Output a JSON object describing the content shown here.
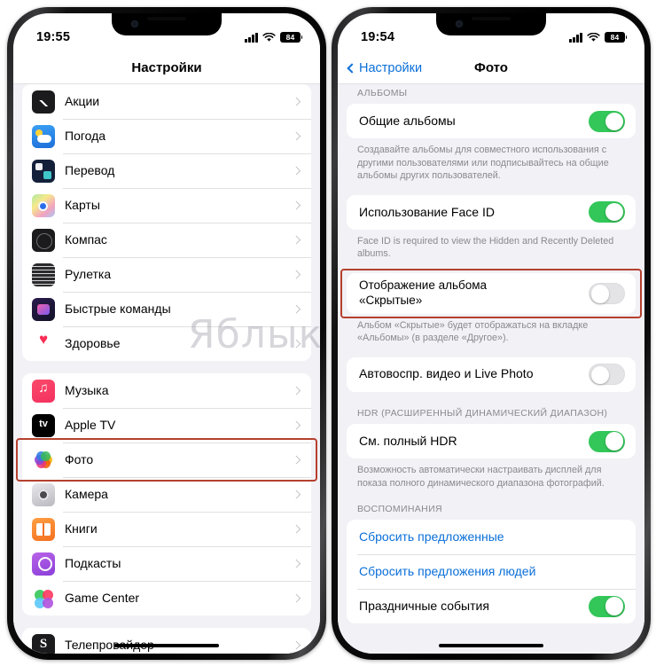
{
  "left_phone": {
    "status_bar": {
      "time": "19:55",
      "battery": "84",
      "signal_icon": "cellular-signal-icon",
      "wifi_icon": "wifi-icon"
    },
    "nav": {
      "title": "Настройки"
    },
    "groups": [
      {
        "name": "apps-group-1",
        "rows": [
          {
            "label": "Акции",
            "icon": "stocks-app-icon",
            "icon_class": "ic-stocks"
          },
          {
            "label": "Погода",
            "icon": "weather-app-icon",
            "icon_class": "ic-weather"
          },
          {
            "label": "Перевод",
            "icon": "translate-app-icon",
            "icon_class": "ic-translate"
          },
          {
            "label": "Карты",
            "icon": "maps-app-icon",
            "icon_class": "ic-maps"
          },
          {
            "label": "Компас",
            "icon": "compass-app-icon",
            "icon_class": "ic-compass"
          },
          {
            "label": "Рулетка",
            "icon": "measure-app-icon",
            "icon_class": "ic-measure"
          },
          {
            "label": "Быстрые команды",
            "icon": "shortcuts-app-icon",
            "icon_class": "ic-shortcuts"
          },
          {
            "label": "Здоровье",
            "icon": "health-app-icon",
            "icon_class": "ic-health"
          }
        ]
      },
      {
        "name": "apps-group-2",
        "rows": [
          {
            "label": "Музыка",
            "icon": "music-app-icon",
            "icon_class": "ic-music"
          },
          {
            "label": "Apple TV",
            "icon": "apple-tv-app-icon",
            "icon_class": "ic-tv"
          },
          {
            "label": "Фото",
            "icon": "photos-app-icon",
            "icon_class": "ic-photos",
            "highlighted": true
          },
          {
            "label": "Камера",
            "icon": "camera-app-icon",
            "icon_class": "ic-camera"
          },
          {
            "label": "Книги",
            "icon": "books-app-icon",
            "icon_class": "ic-books"
          },
          {
            "label": "Подкасты",
            "icon": "podcasts-app-icon",
            "icon_class": "ic-podcasts"
          },
          {
            "label": "Game Center",
            "icon": "game-center-app-icon",
            "icon_class": "ic-gamecenter"
          }
        ]
      },
      {
        "name": "apps-group-3",
        "rows": [
          {
            "label": "Телепровайдер",
            "icon": "tv-provider-app-icon",
            "icon_class": "ic-tele"
          }
        ]
      }
    ]
  },
  "right_phone": {
    "status_bar": {
      "time": "19:54",
      "battery": "84",
      "signal_icon": "cellular-signal-icon",
      "wifi_icon": "wifi-icon"
    },
    "nav": {
      "back_label": "Настройки",
      "title": "Фото"
    },
    "sections": [
      {
        "name": "albums-section",
        "header": "АЛЬБОМЫ",
        "rows": [
          {
            "label": "Общие альбомы",
            "toggle": "on"
          }
        ],
        "footer": "Создавайте альбомы для совместного использования с другими пользователями или подписывайтесь на общие альбомы других пользователей."
      },
      {
        "name": "face-id-section",
        "header": "",
        "rows": [
          {
            "label": "Использование Face ID",
            "toggle": "on"
          }
        ],
        "footer": "Face ID is required to view the Hidden and Recently Deleted albums."
      },
      {
        "name": "hidden-album-section",
        "header": "",
        "rows": [
          {
            "label": "Отображение альбома\n«Скрытые»",
            "toggle": "off",
            "highlighted": true
          }
        ],
        "footer": "Альбом «Скрытые» будет отображаться на вкладке «Альбомы» (в разделе «Другое»)."
      },
      {
        "name": "autoplay-section",
        "header": "",
        "rows": [
          {
            "label": "Автовоспр. видео и Live Photo",
            "toggle": "off"
          }
        ],
        "footer": ""
      },
      {
        "name": "hdr-section",
        "header": "HDR (РАСШИРЕННЫЙ\nДИНАМИЧЕСКИЙ ДИАПАЗОН)",
        "rows": [
          {
            "label": "См. полный HDR",
            "toggle": "on"
          }
        ],
        "footer": "Возможность автоматически настраивать дисплей для показа полного динамического диапазона фотографий."
      },
      {
        "name": "memories-section",
        "header": "ВОСПОМИНАНИЯ",
        "rows": [
          {
            "label": "Сбросить предложенные",
            "type": "link"
          },
          {
            "label": "Сбросить предложения людей",
            "type": "link"
          },
          {
            "label": "Праздничные события",
            "toggle": "on"
          }
        ],
        "footer": ""
      }
    ]
  },
  "watermark": {
    "text": "Яблык"
  },
  "colors": {
    "highlight_box": "#b5402e",
    "toggle_on": "#33c759",
    "toggle_off": "#e4e4e6",
    "link_blue": "#0a6fd8",
    "screen_bg": "#f2f1f6"
  }
}
